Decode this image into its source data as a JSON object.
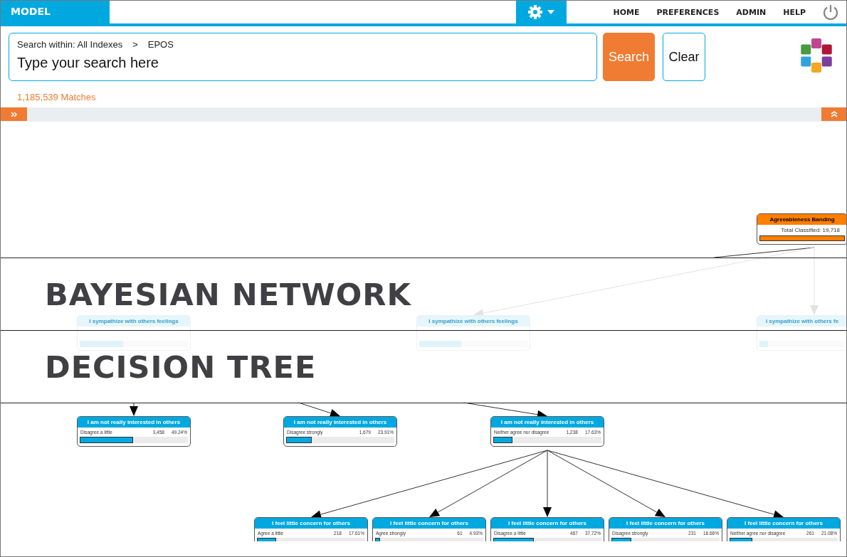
{
  "app": {
    "title": "MODEL"
  },
  "nav": [
    {
      "label": "HOME"
    },
    {
      "label": "PREFERENCES"
    },
    {
      "label": "ADMIN"
    },
    {
      "label": "HELP"
    }
  ],
  "search": {
    "scope": "Search within: All Indexes",
    "separator": ">",
    "index": "EPOS",
    "placeholder": "Type your search here"
  },
  "buttons": [
    {
      "label": "Search",
      "kind": "primary"
    },
    {
      "label": "Clear",
      "kind": "secondary"
    }
  ],
  "matches": "1,185,539 Matches",
  "nodes": [
    {
      "kind": "root",
      "title": "Agreeableness Banding",
      "summary": "Total Classified: 19,718",
      "level": 1
    },
    {
      "kind": "ghost",
      "title": "I sympathize with others feelings",
      "level": 0.4
    },
    {
      "kind": "ghost",
      "title": "I sympathize with others feelings",
      "level": 0.39
    },
    {
      "kind": "ghost",
      "title": "I sympathize with others fe",
      "level": 0.1
    },
    {
      "kind": "node",
      "title": "I am not really interested in others",
      "answer": "Disagree a little",
      "count": "3,458",
      "percent": "49.24%",
      "level": 0.4924
    },
    {
      "kind": "node",
      "title": "I am not really interested in others",
      "answer": "Disagree strongly",
      "count": "1,679",
      "percent": "23.91%",
      "level": 0.2391
    },
    {
      "kind": "node",
      "title": "I am not really interested in others",
      "answer": "Neither agree nor disagree",
      "count": "1,238",
      "percent": "17.63%",
      "level": 0.1763
    },
    {
      "kind": "node",
      "title": "I feel little concern for others",
      "answer": "Agree a little",
      "count": "218",
      "percent": "17.61%",
      "level": 0.1761
    },
    {
      "kind": "node",
      "title": "I feel little concern for others",
      "answer": "Agree strongly",
      "count": "61",
      "percent": "4.93%",
      "level": 0.0493
    },
    {
      "kind": "node",
      "title": "I feel little concern for others",
      "answer": "Disagree a little",
      "count": "467",
      "percent": "37.72%",
      "level": 0.3772
    },
    {
      "kind": "node",
      "title": "I feel little concern for others",
      "answer": "Disagree strongly",
      "count": "231",
      "percent": "18.66%",
      "level": 0.1866
    },
    {
      "kind": "node",
      "title": "I feel little concern for others",
      "answer": "Neither agree nor disagree",
      "count": "261",
      "percent": "21.08%",
      "level": 0.2108
    }
  ],
  "overlays": [
    {
      "title": "BAYESIAN NETWORK"
    },
    {
      "title": "DECISION TREE"
    }
  ]
}
